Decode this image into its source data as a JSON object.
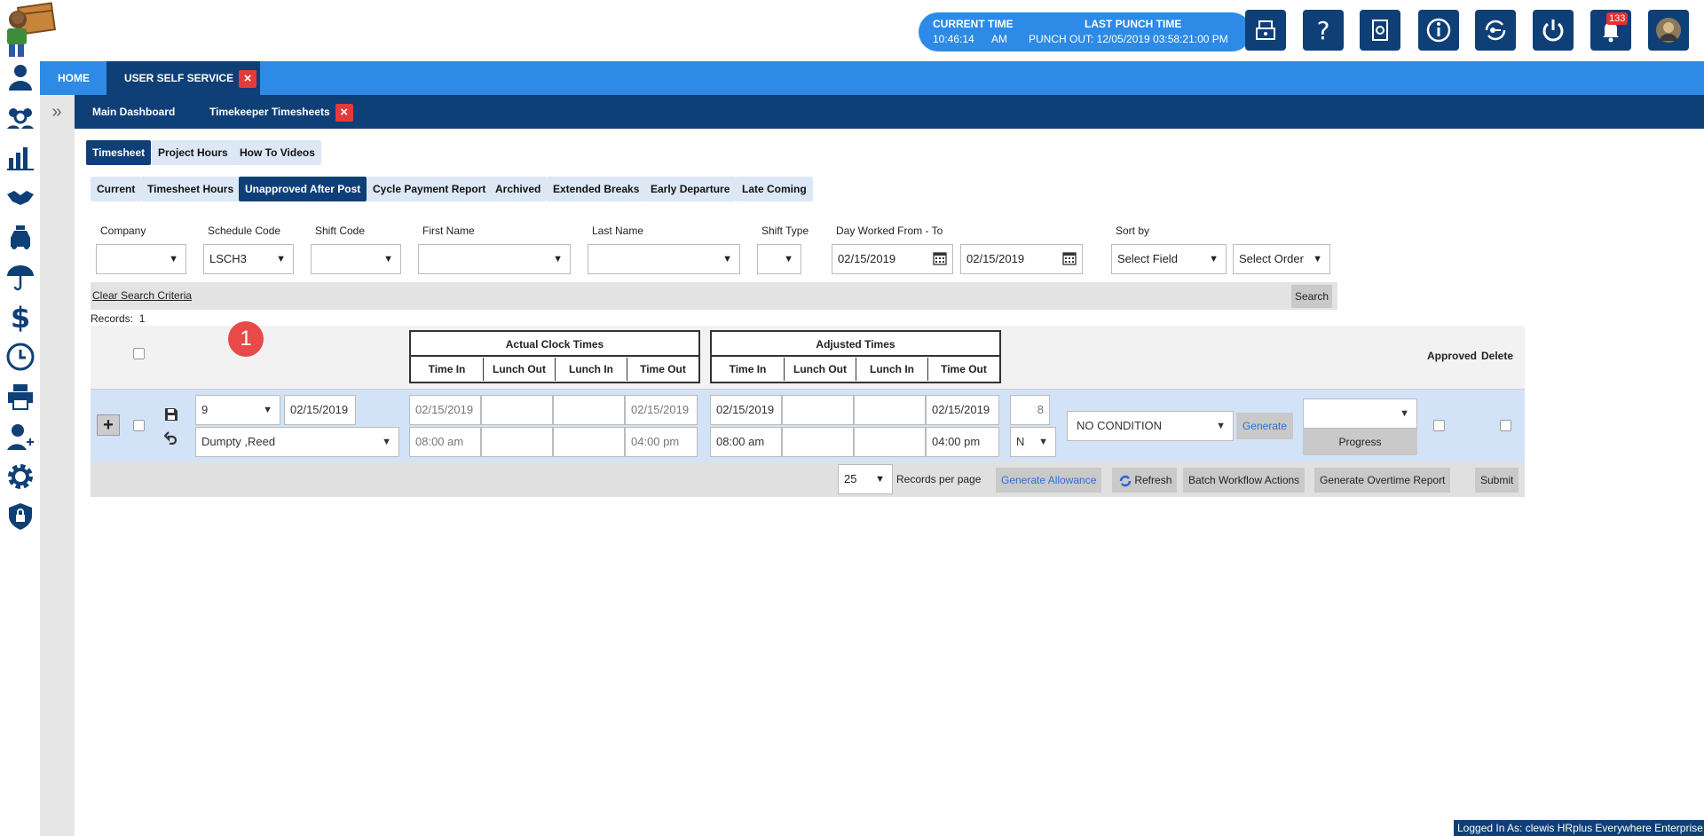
{
  "header": {
    "current_time_label": "CURRENT TIME",
    "current_time_value": "10:46:14",
    "current_time_ampm": "AM",
    "last_punch_label": "LAST PUNCH TIME",
    "last_punch_value": "PUNCH OUT: 12/05/2019 03:58:21:00 PM",
    "notification_count": "133",
    "icons": [
      "cash-drawer-icon",
      "help-icon",
      "settings-book-icon",
      "info-icon",
      "sync-key-icon",
      "power-icon",
      "bell-icon",
      "user-avatar"
    ]
  },
  "sidebar": {
    "icons": [
      "person-icon",
      "team-search-icon",
      "chart-icon",
      "handshake-icon",
      "taxi-icon",
      "umbrella-icon",
      "dollar-icon",
      "clock-icon",
      "printer-icon",
      "add-user-icon",
      "gear-icon",
      "shield-lock-icon"
    ]
  },
  "nav1": {
    "home": "HOME",
    "active": "USER SELF SERVICE",
    "close": "×"
  },
  "nav2": {
    "main_dashboard": "Main Dashboard",
    "active": "Timekeeper Timesheets",
    "close": "×"
  },
  "tabs_primary": [
    {
      "label": "Timesheet",
      "active": true
    },
    {
      "label": "Project Hours",
      "active": false
    },
    {
      "label": "How To Videos",
      "active": false
    }
  ],
  "tabs_secondary": [
    {
      "label": "Current",
      "active": false
    },
    {
      "label": "Timesheet Hours",
      "active": false
    },
    {
      "label": "Unapproved After Post",
      "active": true
    },
    {
      "label": "Cycle Payment Report",
      "active": false
    },
    {
      "label": "Archived",
      "active": false
    },
    {
      "label": "Extended Breaks",
      "active": false
    },
    {
      "label": "Early Departure",
      "active": false
    },
    {
      "label": "Late Coming",
      "active": false
    }
  ],
  "filters": {
    "company_label": "Company",
    "company_value": "",
    "schedule_label": "Schedule Code",
    "schedule_value": "LSCH3",
    "shift_code_label": "Shift Code",
    "shift_code_value": "",
    "first_name_label": "First Name",
    "first_name_value": "",
    "last_name_label": "Last Name",
    "last_name_value": "",
    "shift_type_label": "Shift Type",
    "shift_type_value": "",
    "day_worked_label": "Day Worked From - To",
    "day_from": "02/15/2019",
    "day_to": "02/15/2019",
    "sort_label": "Sort by",
    "sort_field": "Select Field",
    "sort_order": "Select Order",
    "caret": "▼"
  },
  "search": {
    "clear": "Clear Search Criteria",
    "button": "Search",
    "records_label": "Records:",
    "records_count": "1",
    "step_badge": "1"
  },
  "grid": {
    "actual_title": "Actual Clock Times",
    "adjusted_title": "Adjusted Times",
    "cols": [
      "Time In",
      "Lunch Out",
      "Lunch In",
      "Time Out"
    ],
    "approved": "Approved",
    "delete": "Delete"
  },
  "row": {
    "code": "9",
    "date": "02/15/2019",
    "employee": "Dumpty ,Reed",
    "actual_in_date": "02/15/2019",
    "actual_out_date": "02/15/2019",
    "actual_in_time": "08:00 am",
    "actual_out_time": "04:00 pm",
    "adj_in_date": "02/15/2019",
    "adj_out_date": "02/15/2019",
    "adj_in_time": "08:00 am",
    "adj_out_time": "04:00 pm",
    "hours": "8",
    "n_value": "N",
    "condition": "NO CONDITION",
    "generate": "Generate",
    "progress": "Progress"
  },
  "footer": {
    "per_page": "25",
    "per_page_label": "Records per page",
    "generate_allowance": "Generate Allowance",
    "refresh": "Refresh",
    "batch": "Batch Workflow Actions",
    "overtime": "Generate Overtime Report",
    "submit": "Submit"
  },
  "status": {
    "logged_in": "Logged In As: clewis HRplus Everywhere Enterprise"
  },
  "colors": {
    "nav_blue": "#2d8ae6",
    "nav_navy": "#0f3f77",
    "row_blue": "#d2e3f7",
    "badge_red": "#e53a3a"
  }
}
